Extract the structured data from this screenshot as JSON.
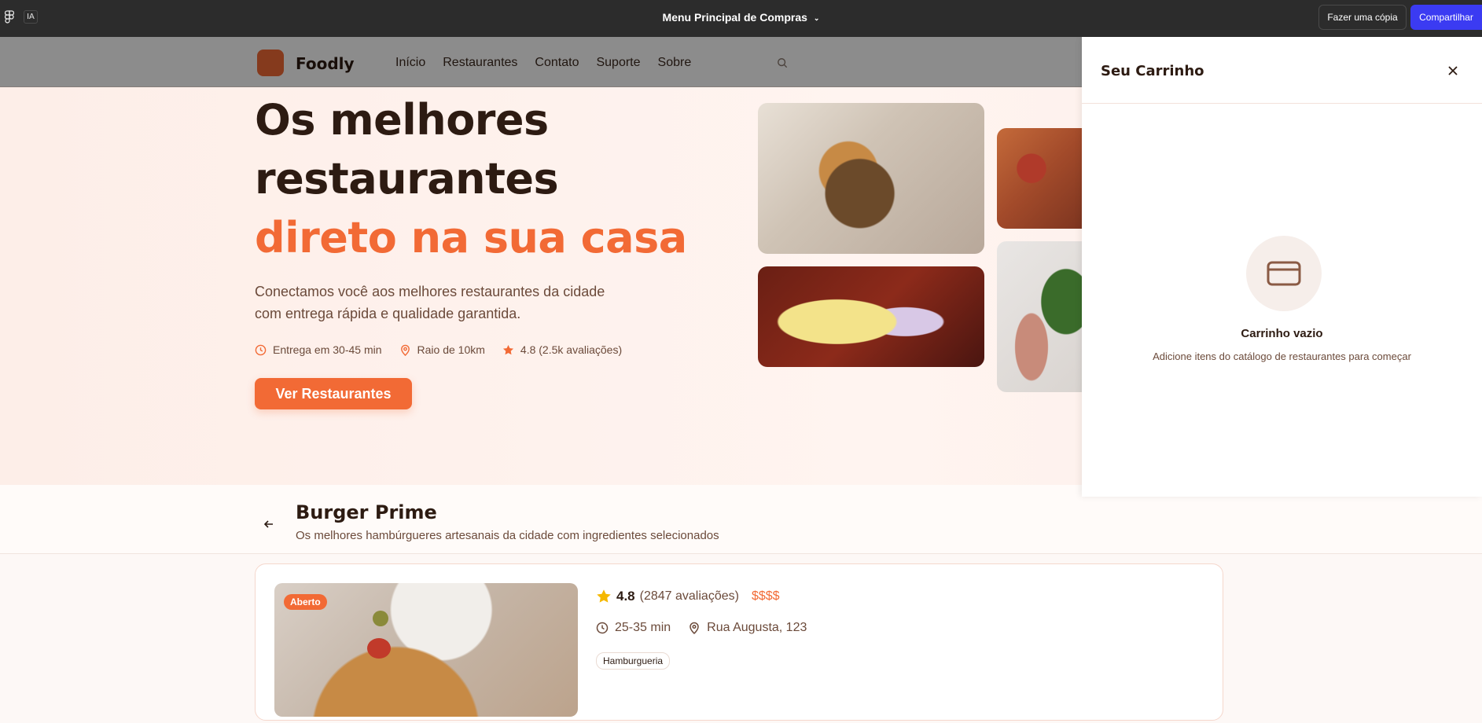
{
  "topbar": {
    "ia_label": "IA",
    "file_title": "Menu Principal de Compras",
    "copy_button": "Fazer uma cópia",
    "share_button": "Compartilhar"
  },
  "navbar": {
    "brand": "Foodly",
    "links": [
      "Início",
      "Restaurantes",
      "Contato",
      "Suporte",
      "Sobre"
    ]
  },
  "hero": {
    "headline_line1": "Os melhores",
    "headline_line2": "restaurantes",
    "headline_accent": "direto na sua casa",
    "subtext": "Conectamos você aos melhores restaurantes da cidade com entrega rápida e qualidade garantida.",
    "features": [
      {
        "icon": "clock-icon",
        "label": "Entrega em 30-45 min"
      },
      {
        "icon": "map-pin-icon",
        "label": "Raio de 10km"
      },
      {
        "icon": "star-icon",
        "label": "4.8 (2.5k avaliações)"
      }
    ],
    "cta_label": "Ver Restaurantes"
  },
  "restaurant": {
    "name": "Burger Prime",
    "description": "Os melhores hambúrgueres artesanais da cidade com ingredientes selecionados",
    "status_badge": "Aberto",
    "rating": "4.8",
    "rating_count": "(2847 avaliações)",
    "price_level": "$$$$",
    "delivery_time": "25-35 min",
    "address": "Rua Augusta, 123",
    "category": "Hamburgueria"
  },
  "cart": {
    "title": "Seu Carrinho",
    "empty_title": "Carrinho vazio",
    "empty_subtitle": "Adicione itens do catálogo de restaurantes para começar"
  },
  "colors": {
    "accent": "#f26a35",
    "dark_text": "#2d1b12",
    "muted_text": "#6b4a3a",
    "share_button": "#3b3bf2",
    "topbar": "#2c2c2c"
  }
}
